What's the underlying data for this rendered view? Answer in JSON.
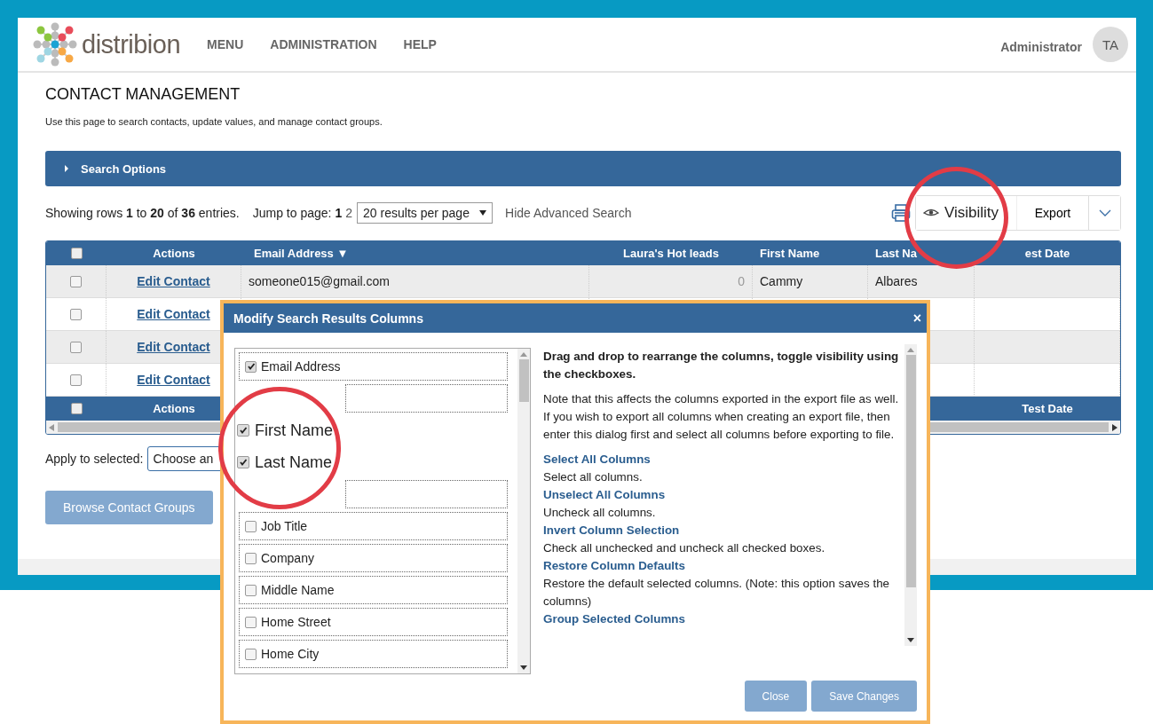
{
  "header": {
    "logo_text": "distribion",
    "nav": [
      "MENU",
      "ADMINISTRATION",
      "HELP"
    ],
    "user": "Administrator",
    "avatar": "TA"
  },
  "page": {
    "title": "CONTACT MANAGEMENT",
    "description": "Use this page to search contacts, update values, and manage contact groups."
  },
  "search_options": {
    "label": "Search Options",
    "expanded": false
  },
  "pager": {
    "summary": "Showing rows **1** to **20** of **36** entries.",
    "jump_label": "Jump to page:",
    "pages": [
      {
        "label": "1",
        "selected": true
      },
      {
        "label": "2",
        "selected": false
      }
    ],
    "per_page": "20 results per page",
    "advanced_link": "Hide Advanced Search"
  },
  "toolbar": {
    "visibility": "Visibility",
    "export": "Export"
  },
  "table": {
    "header_checked": false,
    "columns": [
      "Actions",
      "Email Address ▼",
      "Laura's Hot leads",
      "First Name",
      "Last Na",
      "est Date"
    ],
    "rows": [
      {
        "checked": false,
        "cells": [
          "Edit Contact",
          "someone015@gmail.com",
          "0",
          "Cammy",
          "Albares"
        ]
      },
      {
        "checked": false,
        "cells": [
          "Edit Contact"
        ]
      },
      {
        "checked": false,
        "cells": [
          "Edit Contact"
        ]
      },
      {
        "checked": false,
        "cells": [
          "Edit Contact"
        ]
      }
    ],
    "footer": {
      "checked": false,
      "actions": "Actions",
      "last": "Test Date"
    }
  },
  "apply": {
    "label": "Apply to selected:",
    "value": "Choose an"
  },
  "buttons": [
    "Browse Contact Groups"
  ],
  "dialog": {
    "title": "Modify Search Results Columns",
    "close": "×",
    "columns": [
      {
        "kind": "normal",
        "label": "Email Address",
        "checked": true
      },
      {
        "kind": "covered"
      },
      {
        "kind": "magnified",
        "label": "First Name",
        "checked": true
      },
      {
        "kind": "magnified",
        "label": "Last Name",
        "checked": true
      },
      {
        "kind": "covered"
      },
      {
        "kind": "normal",
        "label": "Job Title",
        "checked": false
      },
      {
        "kind": "normal",
        "label": "Company",
        "checked": false
      },
      {
        "kind": "normal",
        "label": "Middle Name",
        "checked": false
      },
      {
        "kind": "normal",
        "label": "Home Street",
        "checked": false
      },
      {
        "kind": "normal",
        "label": "Home City",
        "checked": false
      }
    ],
    "intro": "Drag and drop to rearrange the columns, toggle visibility using the checkboxes.",
    "note": "Note that this affects the columns exported in the export file as well. If you wish to export all columns when creating an export file, then enter this dialog first and select all columns before exporting to file.",
    "actions": [
      {
        "link": "Select All Columns",
        "text": "Select all columns."
      },
      {
        "link": "Unselect All Columns",
        "text": "Uncheck all columns."
      },
      {
        "link": "Invert Column Selection",
        "text": "Check all unchecked and uncheck all checked boxes."
      },
      {
        "link": "Restore Column Defaults",
        "text": "Restore the default selected columns. (Note: this option saves the columns)"
      },
      {
        "link": "Group Selected Columns"
      }
    ],
    "buttons": [
      "Close",
      "Save Changes"
    ]
  }
}
